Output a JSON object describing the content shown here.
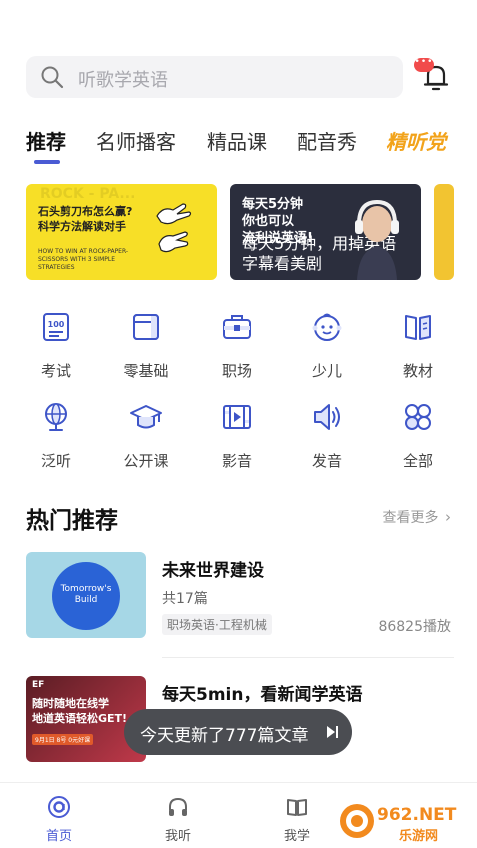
{
  "search": {
    "placeholder": "听歌学英语",
    "icon": "search-icon"
  },
  "notifications": {
    "icon": "bell-icon",
    "badge": "•••"
  },
  "tabs": [
    {
      "label": "推荐",
      "active": true
    },
    {
      "label": "名师播客"
    },
    {
      "label": "精品课"
    },
    {
      "label": "配音秀"
    },
    {
      "label": "精听党"
    }
  ],
  "banners": [
    {
      "title_line1": "石头剪刀布怎么赢?",
      "title_line2": "科学方法解读对手",
      "subtitle": "HOW TO WIN AT ROCK-PAPER-SCISSORS WITH 3 SIMPLE STRATEGIES",
      "bg_text": "ROCK - PA...",
      "color": "#f7df27"
    },
    {
      "title_line1": "每天5分钟",
      "title_line2": "你也可以",
      "title_line3": "流利说英语!",
      "overlay_line1": "每天5分钟，用掉英语",
      "overlay_line2": "字幕看美剧",
      "color": "#2b2e3d"
    }
  ],
  "categories": [
    {
      "label": "考试",
      "icon": "exam-icon"
    },
    {
      "label": "零基础",
      "icon": "folder-icon"
    },
    {
      "label": "职场",
      "icon": "briefcase-icon"
    },
    {
      "label": "少儿",
      "icon": "child-icon"
    },
    {
      "label": "教材",
      "icon": "book-icon"
    },
    {
      "label": "泛听",
      "icon": "globe-icon"
    },
    {
      "label": "公开课",
      "icon": "graduation-cap-icon"
    },
    {
      "label": "影音",
      "icon": "film-icon"
    },
    {
      "label": "发音",
      "icon": "speaker-icon"
    },
    {
      "label": "全部",
      "icon": "grid-icon"
    }
  ],
  "hot": {
    "title": "热门推荐",
    "more": "查看更多",
    "items": [
      {
        "title": "未来世界建设",
        "count": "共17篇",
        "tag": "职场英语·工程机械",
        "plays": "86825播放",
        "thumb_text": "Tomorrow's Build"
      },
      {
        "title": "每天5min，看新闻学英语",
        "thumb_brand": "EF",
        "thumb_line1": "随时随地在线学",
        "thumb_line2": "地道英语轻松GET!",
        "thumb_badge": "9月1日 8号 0元好课"
      }
    ]
  },
  "toast": {
    "text": "今天更新了777篇文章",
    "icon": "play-next-icon"
  },
  "tabbar": [
    {
      "label": "首页",
      "icon": "home-icon",
      "active": true
    },
    {
      "label": "我听",
      "icon": "headphones-icon"
    },
    {
      "label": "我学",
      "icon": "open-book-icon"
    }
  ],
  "watermark": {
    "line1": "962.NET",
    "line2": "乐游网"
  },
  "colors": {
    "accent": "#4a5bd4",
    "icon_blue": "#3e55c8",
    "badge_red": "#f14b4b",
    "special_tab": "#f2a31b"
  }
}
